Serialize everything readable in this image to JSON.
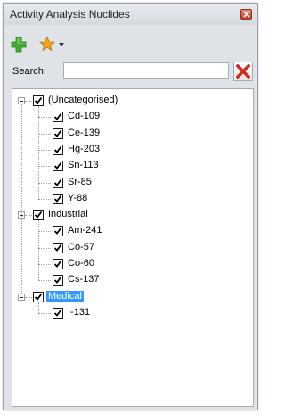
{
  "window": {
    "title": "Activity Analysis Nuclides"
  },
  "toolbar": {
    "add_icon": "green-plus-icon",
    "favorite_icon": "star-icon"
  },
  "search": {
    "label": "Search:",
    "value": "",
    "clear_icon": "red-x-icon"
  },
  "tree": {
    "groups": [
      {
        "label": "(Uncategorised)",
        "checked": true,
        "expanded": true,
        "selected": false,
        "items": [
          "Cd-109",
          "Ce-139",
          "Hg-203",
          "Sn-113",
          "Sr-85",
          "Y-88"
        ]
      },
      {
        "label": "Industrial",
        "checked": true,
        "expanded": true,
        "selected": false,
        "items": [
          "Am-241",
          "Co-57",
          "Co-60",
          "Cs-137"
        ]
      },
      {
        "label": "Medical",
        "checked": true,
        "expanded": true,
        "selected": true,
        "items": [
          "I-131"
        ]
      }
    ]
  },
  "colors": {
    "selection": "#3399ff",
    "add": "#3fae2a",
    "star": "#f2a51a",
    "clear": "#d32a1e"
  }
}
